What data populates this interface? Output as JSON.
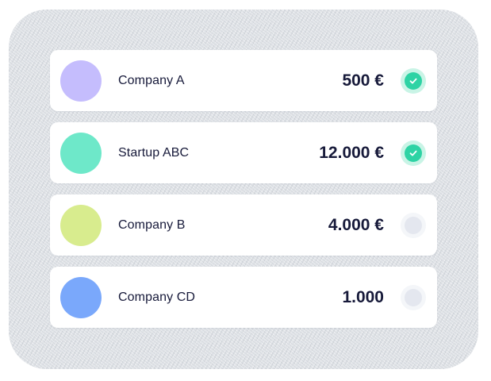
{
  "payments": [
    {
      "name": "Company A",
      "amount": "500 €",
      "avatar_color": "#c5bdfd",
      "checked": true
    },
    {
      "name": "Startup ABC",
      "amount": "12.000 €",
      "avatar_color": "#6ee8c9",
      "checked": true
    },
    {
      "name": "Company B",
      "amount": "4.000 €",
      "avatar_color": "#d8ec8e",
      "checked": false
    },
    {
      "name": "Company CD",
      "amount": "1.000",
      "avatar_color": "#7aa8fb",
      "checked": false
    }
  ],
  "colors": {
    "check_outer": "#c9f4e6",
    "check_inner": "#2ed3a4",
    "unchecked_outer": "#f4f6f9",
    "unchecked_inner": "#e4e7ef",
    "text": "#171a3a"
  },
  "icons": {
    "checked": "check-icon"
  }
}
